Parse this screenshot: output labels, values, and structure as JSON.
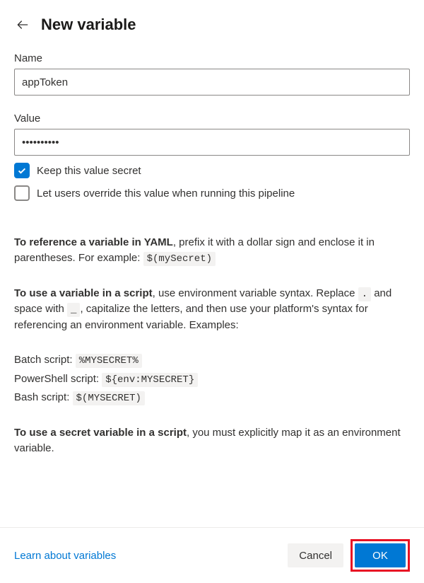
{
  "header": {
    "title": "New variable"
  },
  "fields": {
    "name": {
      "label": "Name",
      "value": "appToken"
    },
    "value": {
      "label": "Value",
      "value": "••••••••••"
    }
  },
  "checkboxes": {
    "secret": {
      "label": "Keep this value secret",
      "checked": true
    },
    "override": {
      "label": "Let users override this value when running this pipeline",
      "checked": false
    }
  },
  "help": {
    "yaml_bold": "To reference a variable in YAML",
    "yaml_rest": ", prefix it with a dollar sign and enclose it in parentheses. For example: ",
    "yaml_example": "$(mySecret)",
    "script_bold": "To use a variable in a script",
    "script_rest1": ", use environment variable syntax. Replace ",
    "dot": ".",
    "script_rest2": " and space with ",
    "under": "_",
    "script_rest3": ", capitalize the letters, and then use your platform's syntax for referencing an environment variable. Examples:",
    "batch_label": "Batch script: ",
    "batch_code": "%MYSECRET%",
    "ps_label": "PowerShell script: ",
    "ps_code": "${env:MYSECRET}",
    "bash_label": "Bash script: ",
    "bash_code": "$(MYSECRET)",
    "secret_bold": "To use a secret variable in a script",
    "secret_rest": ", you must explicitly map it as an environment variable."
  },
  "footer": {
    "learn": "Learn about variables",
    "cancel": "Cancel",
    "ok": "OK"
  }
}
